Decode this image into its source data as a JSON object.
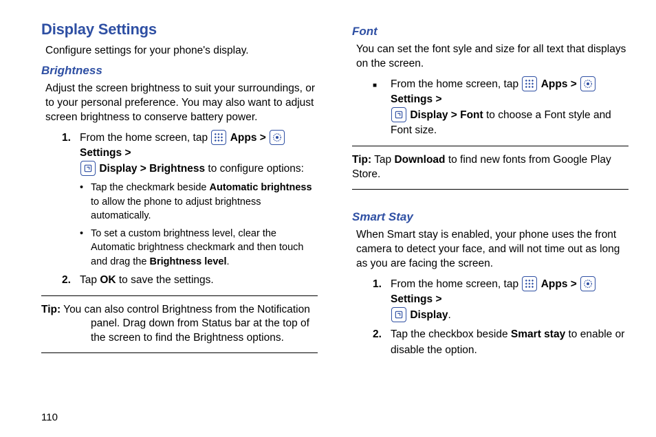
{
  "pageNumber": "110",
  "col1": {
    "h1": "Display Settings",
    "intro": "Configure settings for your phone's display.",
    "brightness": {
      "heading": "Brightness",
      "desc": "Adjust the screen brightness to suit your surroundings, or to your personal preference. You may also want to adjust screen brightness to conserve battery power.",
      "step1_pre": "From the home screen, tap ",
      "apps": "Apps",
      "gt": " > ",
      "settings": "Settings",
      "step1_mid": "Display > Brightness",
      "step1_post": " to configure options:",
      "bullet1_pre": "Tap the checkmark beside ",
      "bullet1_bold": "Automatic brightness",
      "bullet1_post": " to allow the phone to adjust brightness automatically.",
      "bullet2_pre": "To set a custom brightness level, clear the Automatic brightness checkmark and then touch and drag the ",
      "bullet2_bold": "Brightness level",
      "bullet2_post": ".",
      "step2_pre": "Tap ",
      "step2_bold": "OK",
      "step2_post": " to save the settings.",
      "tip_label": "Tip:",
      "tip_line1": " You can also control Brightness from the Notification",
      "tip_line2": "panel. Drag down from Status bar at the top of the screen to find the Brightness options."
    }
  },
  "col2": {
    "font": {
      "heading": "Font",
      "desc": "You can set the font syle and size for all text that displays on the screen.",
      "step_pre": "From the home screen, tap ",
      "apps": "Apps",
      "gt": " > ",
      "settings": "Settings",
      "step_mid": "Display > Font",
      "step_post": " to choose a Font style and Font size.",
      "tip_label": "Tip:",
      "tip_pre": " Tap ",
      "tip_bold": "Download",
      "tip_post": " to find new fonts from Google Play Store."
    },
    "smart": {
      "heading": "Smart Stay",
      "desc": "When Smart stay is enabled, your phone uses the front camera to detect your face, and will not time out as long as you are facing the screen.",
      "step1_pre": "From the home screen, tap ",
      "apps": "Apps",
      "gt": " > ",
      "settings": "Settings",
      "step1_bold": "Display",
      "step1_post": ".",
      "step2_pre": "Tap the checkbox beside ",
      "step2_bold": "Smart stay",
      "step2_post": " to enable or disable the option."
    }
  }
}
